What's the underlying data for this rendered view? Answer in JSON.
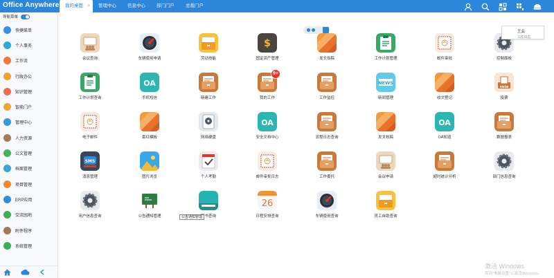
{
  "app_title": "Office Anywhere",
  "tabs": [
    {
      "label": "我的桌面",
      "active": true,
      "closable": "×"
    },
    {
      "label": "管理中心",
      "active": false
    },
    {
      "label": "信息中心",
      "active": false
    },
    {
      "label": "部门门户",
      "active": false
    },
    {
      "label": "总裁门户",
      "active": false
    }
  ],
  "top_icons": [
    "user-icon",
    "search-icon",
    "org-chart-icon",
    "apps-grid-icon",
    "hat-icon"
  ],
  "sidebar": {
    "toggle_label": "导航菜单",
    "items": [
      {
        "label": "快捷菜单",
        "icon": "star-icon",
        "color": "#3b8fe0"
      },
      {
        "label": "个人事务",
        "icon": "person-icon",
        "color": "#2ea7d9"
      },
      {
        "label": "工作流",
        "icon": "flow-icon",
        "color": "#f0783c"
      },
      {
        "label": "行政办公",
        "icon": "briefcase-icon",
        "color": "#f3a12b"
      },
      {
        "label": "知识管理",
        "icon": "book-icon",
        "color": "#ec6c4b"
      },
      {
        "label": "智能门户",
        "icon": "portal-icon",
        "color": "#f1a533"
      },
      {
        "label": "管理中心",
        "icon": "manage-icon",
        "color": "#2f9bd8"
      },
      {
        "label": "人力资源",
        "icon": "people-icon",
        "color": "#a57b5a"
      },
      {
        "label": "公文管理",
        "icon": "document-icon",
        "color": "#46b35a"
      },
      {
        "label": "档案管理",
        "icon": "archive-icon",
        "color": "#37a7d7"
      },
      {
        "label": "项目管理",
        "icon": "project-icon",
        "color": "#f28a2b"
      },
      {
        "label": "ERP应用",
        "icon": "erp-icon",
        "color": "#2f8fdf"
      },
      {
        "label": "交流园地",
        "icon": "chat-icon",
        "color": "#3eae54"
      },
      {
        "label": "附件程序",
        "icon": "attachment-icon",
        "color": "#9c7a5a"
      },
      {
        "label": "系统管理",
        "icon": "gear-icon",
        "color": "#3cad53"
      }
    ],
    "bottom_icons": [
      "home-icon",
      "cloud-icon",
      "collapse-arrow-icon"
    ]
  },
  "apps": [
    {
      "label": "会议查询",
      "icon": "meeting-icon"
    },
    {
      "label": "车辆使用申请",
      "icon": "vehicle-dial-icon"
    },
    {
      "label": "劳动技能",
      "icon": "yellow-folder-icon"
    },
    {
      "label": "固定资产管理",
      "icon": "asset-dollar-icon"
    },
    {
      "label": "发文拟稿",
      "icon": "orange-stripes-icon"
    },
    {
      "label": "工作计划管理",
      "icon": "green-clipboard-icon"
    },
    {
      "label": "邮件审批",
      "icon": "stamp-mail-icon"
    },
    {
      "label": "控制面板",
      "icon": "gear-gray-icon"
    },
    {
      "label": "工作计划查询",
      "icon": "green-clipboard-icon"
    },
    {
      "label": "手机短信",
      "icon": "oa-teal-icon",
      "text": "OA"
    },
    {
      "label": "新建工作",
      "icon": "brown-folder-icon"
    },
    {
      "label": "我的工作",
      "icon": "brown-folder-icon",
      "badge": "9+"
    },
    {
      "label": "工作监控",
      "icon": "brown-folder-icon"
    },
    {
      "label": "新闻管理",
      "icon": "news-icon",
      "text": "NEWS"
    },
    {
      "label": "收文登记",
      "icon": "orange-stripes-icon"
    },
    {
      "label": "投票",
      "icon": "vote-icon",
      "text": "vote"
    },
    {
      "label": "电子邮件",
      "icon": "stamp-mail-icon"
    },
    {
      "label": "套红模板",
      "icon": "orange-stripes-icon"
    },
    {
      "label": "网络硬盘",
      "icon": "disk-icon"
    },
    {
      "label": "安全文档中心",
      "icon": "oa-teal-icon",
      "text": "OA"
    },
    {
      "label": "流程日志查询",
      "icon": "brown-folder-icon"
    },
    {
      "label": "发文核稿",
      "icon": "orange-stripes-icon"
    },
    {
      "label": "OA知道",
      "icon": "oa-teal-icon",
      "text": "OA"
    },
    {
      "label": "数据报表",
      "icon": "brown-folder-icon"
    },
    {
      "label": "消息管理",
      "icon": "sms-icon",
      "text": "SMS"
    },
    {
      "label": "图片浏览",
      "icon": "picture-icon"
    },
    {
      "label": "个人考勤",
      "icon": "check-icon"
    },
    {
      "label": "邮件审批日志",
      "icon": "stamp-mail-icon"
    },
    {
      "label": "工作委托",
      "icon": "brown-folder-icon"
    },
    {
      "label": "会议申请",
      "icon": "meeting-icon"
    },
    {
      "label": "超时统计分析",
      "icon": "brown-folder-icon"
    },
    {
      "label": "部门信息查询",
      "icon": "gear-gray-icon"
    },
    {
      "label": "用户信息查询",
      "icon": "gear-gray-icon"
    },
    {
      "label": "公告通知管理",
      "icon": "blackboard-icon"
    },
    {
      "label": "图书查询",
      "icon": "teal-book-icon"
    },
    {
      "label": "日程安排查询",
      "icon": "calendar-icon",
      "text": "26"
    },
    {
      "label": "车辆使用查询",
      "icon": "vehicle-dial-icon"
    },
    {
      "label": "员工自助查询",
      "icon": "yellow-folder-icon"
    }
  ],
  "tooltip": "公告通知管理",
  "user_card": {
    "name": "王云",
    "subtitle": "工作日志"
  },
  "activation": {
    "line1": "激活 Windows",
    "line2": "转到\"电脑设置\"以激活 Windows。"
  }
}
